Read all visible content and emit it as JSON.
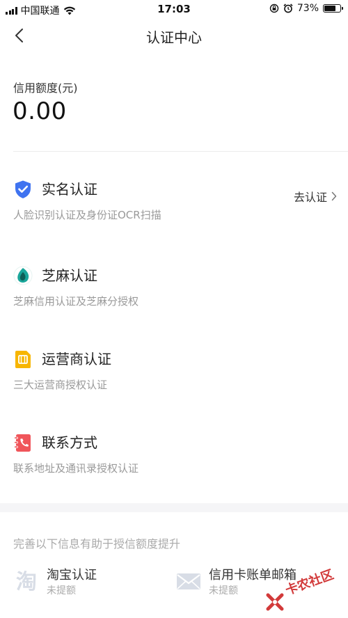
{
  "status_bar": {
    "carrier": "中国联通",
    "time": "17:03",
    "battery": "73%",
    "battery_level": 0.73
  },
  "nav": {
    "title": "认证中心"
  },
  "credit": {
    "label": "信用额度(元)",
    "value": "0.00"
  },
  "certifications": [
    {
      "icon": "shield-check-icon",
      "title": "实名认证",
      "desc": "人脸识别认证及身份证OCR扫描",
      "action": "去认证"
    },
    {
      "icon": "sesame-icon",
      "title": "芝麻认证",
      "desc": "芝麻信用认证及芝麻分授权"
    },
    {
      "icon": "sim-card-icon",
      "title": "运营商认证",
      "desc": "三大运营商授权认证"
    },
    {
      "icon": "phone-book-icon",
      "title": "联系方式",
      "desc": "联系地址及通讯录授权认证"
    }
  ],
  "extra": {
    "hint": "完善以下信息有助于授信额度提升",
    "items": [
      {
        "icon": "taobao-icon",
        "title": "淘宝认证",
        "sub": "未提额"
      },
      {
        "icon": "mail-icon",
        "title": "信用卡账单邮箱",
        "sub": "未提额"
      }
    ]
  },
  "watermark": {
    "text": "卡农社区"
  },
  "colors": {
    "shield": "#3f73f0",
    "sesame": "#1aa69a",
    "sim": "#f7b500",
    "contact": "#f0555a",
    "muted": "#999999"
  }
}
